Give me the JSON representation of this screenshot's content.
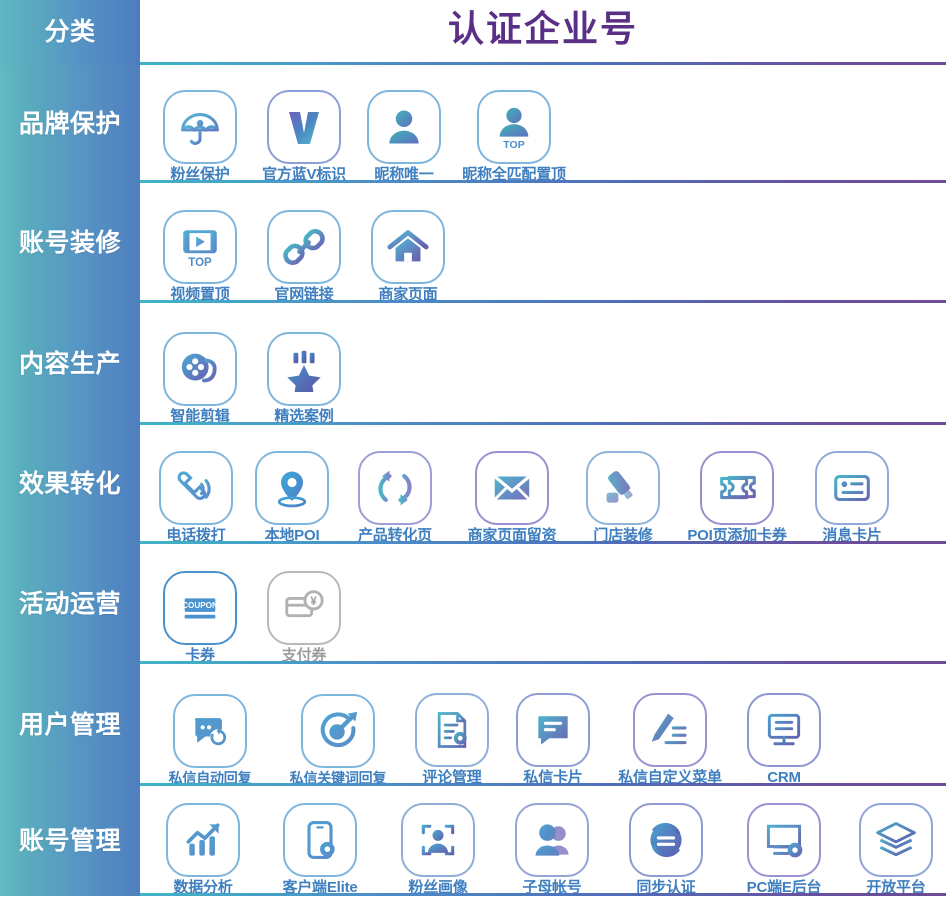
{
  "header": {
    "category_label": "分类",
    "title": "认证企业号"
  },
  "colors": {
    "sidebar_start": "#64b9c2",
    "sidebar_end": "#4f7fc0",
    "title_purple": "#5a2f86",
    "caption_blue": "#3f7fc0",
    "divider_start": "#3fb4c4",
    "divider_end": "#6b4c95",
    "muted_grey": "#9a9c9e"
  },
  "rows": [
    {
      "category": "品牌保护",
      "items": [
        {
          "label": "粉丝保护",
          "icon": "umbrella-icon"
        },
        {
          "label": "官方蓝V标识",
          "icon": "blue-v-badge-icon"
        },
        {
          "label": "昵称唯一",
          "icon": "person-icon"
        },
        {
          "label": "昵称全匹配置顶",
          "icon": "person-top-icon"
        }
      ]
    },
    {
      "category": "账号装修",
      "items": [
        {
          "label": "视频置顶",
          "icon": "video-top-icon"
        },
        {
          "label": "官网链接",
          "icon": "link-chain-icon"
        },
        {
          "label": "商家页面",
          "icon": "home-icon"
        }
      ]
    },
    {
      "category": "内容生产",
      "items": [
        {
          "label": "智能剪辑",
          "icon": "film-reel-icon"
        },
        {
          "label": "精选案例",
          "icon": "star-badge-icon"
        }
      ]
    },
    {
      "category": "效果转化",
      "items": [
        {
          "label": "电话拨打",
          "icon": "phone-call-icon"
        },
        {
          "label": "本地POI",
          "icon": "map-pin-icon"
        },
        {
          "label": "产品转化页",
          "icon": "refresh-cycle-icon"
        },
        {
          "label": "商家页面留资",
          "icon": "envelope-icon"
        },
        {
          "label": "门店装修",
          "icon": "paint-roller-icon"
        },
        {
          "label": "POI页添加卡券",
          "icon": "ticket-icon"
        },
        {
          "label": "消息卡片",
          "icon": "message-card-icon"
        }
      ]
    },
    {
      "category": "活动运营",
      "items": [
        {
          "label": "卡券",
          "icon": "coupon-icon",
          "state": "active"
        },
        {
          "label": "支付券",
          "icon": "payment-card-yen-icon",
          "state": "muted"
        }
      ]
    },
    {
      "category": "用户管理",
      "items": [
        {
          "label": "私信自动回复",
          "icon": "chat-auto-reply-icon"
        },
        {
          "label": "私信关键词回复",
          "icon": "target-arrow-icon"
        },
        {
          "label": "评论管理",
          "icon": "document-gear-icon"
        },
        {
          "label": "私信卡片",
          "icon": "chat-card-icon"
        },
        {
          "label": "私信自定义菜单",
          "icon": "pen-list-icon"
        },
        {
          "label": "CRM",
          "icon": "monitor-list-icon"
        }
      ]
    },
    {
      "category": "账号管理",
      "items": [
        {
          "label": "数据分析",
          "icon": "bar-chart-arrow-icon"
        },
        {
          "label": "客户端Elite",
          "icon": "phone-gear-icon"
        },
        {
          "label": "粉丝画像",
          "icon": "person-scan-icon"
        },
        {
          "label": "子母帐号",
          "icon": "two-persons-icon"
        },
        {
          "label": "同步认证",
          "icon": "sync-circle-icon"
        },
        {
          "label": "PC端E后台",
          "icon": "desktop-gear-icon"
        },
        {
          "label": "开放平台",
          "icon": "layers-icon"
        }
      ]
    }
  ]
}
